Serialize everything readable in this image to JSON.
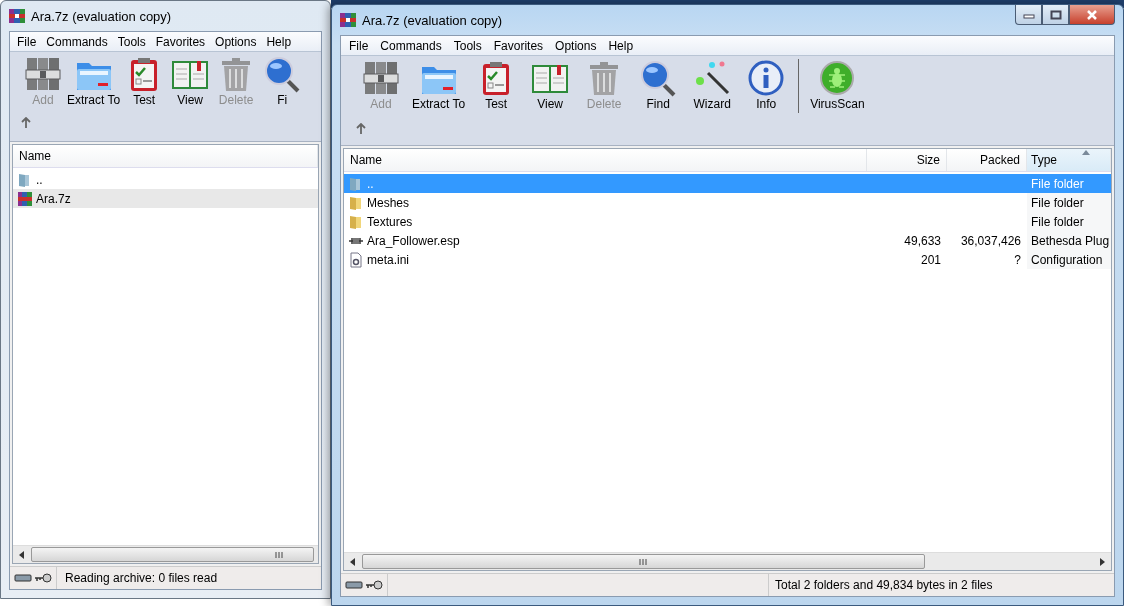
{
  "windows": [
    {
      "title": "Ara.7z (evaluation copy)",
      "active": false,
      "menu": [
        "File",
        "Commands",
        "Tools",
        "Favorites",
        "Options",
        "Help"
      ],
      "toolbar_groups": [
        [
          {
            "label": "Add",
            "kind": "archive",
            "disabled": true
          },
          {
            "label": "Extract To",
            "kind": "folder",
            "disabled": false
          },
          {
            "label": "Test",
            "kind": "clipboard",
            "disabled": false
          },
          {
            "label": "View",
            "kind": "book",
            "disabled": false
          },
          {
            "label": "Delete",
            "kind": "trash",
            "disabled": true
          },
          {
            "label": "Fi",
            "kind": "magnifier",
            "disabled": false
          }
        ]
      ],
      "columns": [
        {
          "label": "Name",
          "kind": "name",
          "sorted": false
        }
      ],
      "rows": [
        {
          "kind": "up",
          "selected": false,
          "cells": [
            ".."
          ]
        },
        {
          "kind": "archive",
          "selected": true,
          "cells": [
            "Ara.7z"
          ]
        }
      ],
      "status": "Reading archive: 0 files read"
    },
    {
      "title": "Ara.7z (evaluation copy)",
      "active": true,
      "menu": [
        "File",
        "Commands",
        "Tools",
        "Favorites",
        "Options",
        "Help"
      ],
      "toolbar_groups": [
        [
          {
            "label": "Add",
            "kind": "archive",
            "disabled": true
          },
          {
            "label": "Extract To",
            "kind": "folder",
            "disabled": false
          },
          {
            "label": "Test",
            "kind": "clipboard",
            "disabled": false
          },
          {
            "label": "View",
            "kind": "book",
            "disabled": false
          },
          {
            "label": "Delete",
            "kind": "trash",
            "disabled": true
          },
          {
            "label": "Find",
            "kind": "magnifier",
            "disabled": false
          },
          {
            "label": "Wizard",
            "kind": "wand",
            "disabled": false
          },
          {
            "label": "Info",
            "kind": "info",
            "disabled": false
          }
        ],
        [
          {
            "label": "VirusScan",
            "kind": "bug",
            "disabled": false
          }
        ]
      ],
      "columns": [
        {
          "label": "Name",
          "kind": "name",
          "sorted": false
        },
        {
          "label": "Size",
          "kind": "num",
          "sorted": false
        },
        {
          "label": "Packed",
          "kind": "num",
          "sorted": false
        },
        {
          "label": "Type",
          "kind": "type",
          "sorted": true
        }
      ],
      "rows": [
        {
          "kind": "up",
          "selected": true,
          "cells": [
            "..",
            "",
            "",
            "File folder"
          ]
        },
        {
          "kind": "folder",
          "selected": false,
          "cells": [
            "Meshes",
            "",
            "",
            "File folder"
          ]
        },
        {
          "kind": "folder",
          "selected": false,
          "cells": [
            "Textures",
            "",
            "",
            "File folder"
          ]
        },
        {
          "kind": "plugin",
          "selected": false,
          "cells": [
            "Ara_Follower.esp",
            "49,633",
            "36,037,426",
            "Bethesda Plug"
          ]
        },
        {
          "kind": "doc",
          "selected": false,
          "cells": [
            "meta.ini",
            "201",
            "?",
            "Configuration"
          ]
        }
      ],
      "status": "Total 2 folders and 49,834 bytes in 2 files"
    }
  ]
}
